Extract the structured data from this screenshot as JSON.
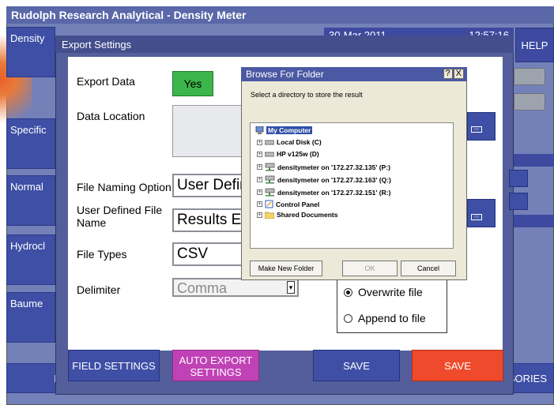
{
  "window": {
    "title": "Rudolph Research Analytical - Density Meter"
  },
  "header": {
    "date": "30-Mar 2011",
    "time": "12:57:16",
    "help_label": "HELP"
  },
  "sidebar": {
    "items": [
      {
        "label": "Density"
      },
      {
        "label": "Specific"
      },
      {
        "label": "Normal"
      },
      {
        "label": "Hydrocl"
      },
      {
        "label": "Baume"
      }
    ]
  },
  "bottom_nav": {
    "left_label": "ME",
    "right_label": "SORIES"
  },
  "export_dialog": {
    "title": "Export Settings",
    "export_data_label": "Export Data",
    "export_data_value": "Yes",
    "data_location_label": "Data Location",
    "naming_label": "File Naming Option",
    "naming_value": "User Defin",
    "user_file_label": "User Defined File Name",
    "user_file_value": "Results Ex",
    "file_types_label": "File Types",
    "file_types_value": "CSV",
    "delimiter_label": "Delimiter",
    "delimiter_value": "Comma",
    "radio_overwrite": "Overwrite file",
    "radio_append": "Append to file",
    "field_settings_btn": "FIELD SETTINGS",
    "auto_export_btn": "AUTO EXPORT SETTINGS",
    "save_btn": "SAVE",
    "save_btn2": "SAVE",
    "colors": {
      "yes": "#3cb54a",
      "auto_export": "#c042b6",
      "save_red": "#ef4a2b"
    }
  },
  "browse": {
    "title": "Browse For Folder",
    "help": "?",
    "close": "X",
    "instruction": "Select a directory to store the result",
    "tree": [
      {
        "label": "My Computer",
        "icon": "computer-icon",
        "selected": true
      },
      {
        "label": "Local Disk (C)",
        "icon": "drive-icon"
      },
      {
        "label": "HP v125w (D)",
        "icon": "drive-icon"
      },
      {
        "label": "densitymeter on '172.27.32.135' (P:)",
        "icon": "network-drive-icon"
      },
      {
        "label": "densitymeter on '172.27.32.163' (Q:)",
        "icon": "network-drive-icon"
      },
      {
        "label": "densitymeter on '172.27.32.151' (R:)",
        "icon": "network-drive-icon"
      },
      {
        "label": "Control Panel",
        "icon": "control-panel-icon"
      },
      {
        "label": "Shared Documents",
        "icon": "folder-icon"
      }
    ],
    "make_folder": "Make New Folder",
    "ok": "OK",
    "cancel": "Cancel"
  }
}
